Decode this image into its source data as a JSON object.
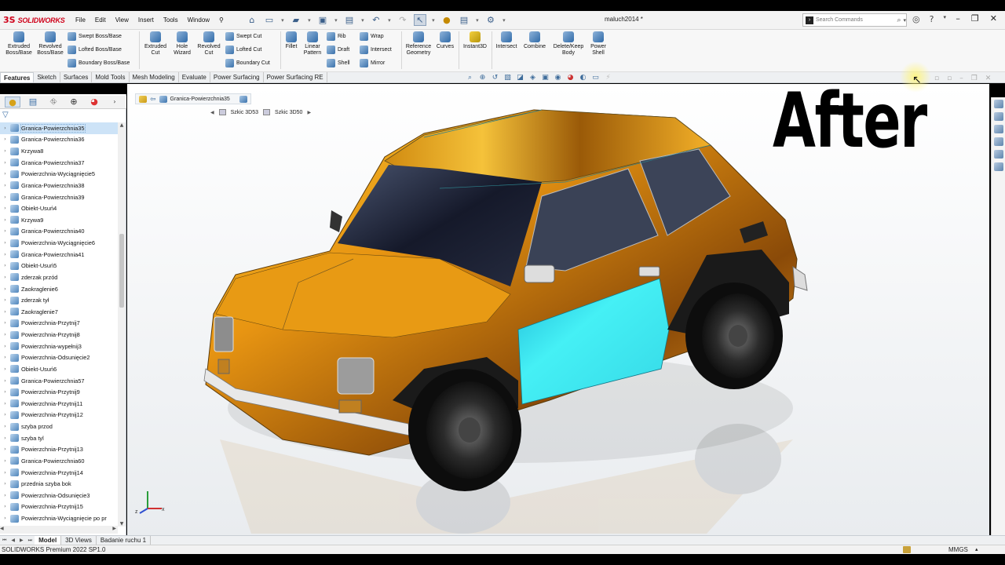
{
  "app": {
    "logo_mark": "3S",
    "logo_text": "SOLIDWORKS",
    "document_title": "maluch2014 *"
  },
  "menu": [
    "File",
    "Edit",
    "View",
    "Insert",
    "Tools",
    "Window"
  ],
  "search": {
    "placeholder": "Search Commands"
  },
  "ribbon": {
    "extruded_boss": "Extruded Boss/Base",
    "revolved_boss": "Revolved Boss/Base",
    "swept_boss": "Swept Boss/Base",
    "lofted_boss": "Lofted Boss/Base",
    "boundary_boss": "Boundary Boss/Base",
    "extruded_cut": "Extruded Cut",
    "hole_wizard": "Hole Wizard",
    "revolved_cut": "Revolved Cut",
    "swept_cut": "Swept Cut",
    "lofted_cut": "Lofted Cut",
    "boundary_cut": "Boundary Cut",
    "fillet": "Fillet",
    "linear_pattern": "Linear Pattern",
    "rib": "Rib",
    "draft": "Draft",
    "shell": "Shell",
    "wrap": "Wrap",
    "intersect_small": "Intersect",
    "mirror": "Mirror",
    "reference_geometry": "Reference Geometry",
    "curves": "Curves",
    "instant3d": "Instant3D",
    "intersect": "Intersect",
    "combine": "Combine",
    "delete_keep_body": "Delete/Keep Body",
    "power_shell": "Power Shell"
  },
  "tabs": [
    "Features",
    "Sketch",
    "Surfaces",
    "Mold Tools",
    "Mesh Modeling",
    "Evaluate",
    "Power Surfacing",
    "Power Surfacing RE"
  ],
  "breadcrumb": {
    "feature": "Granica-Powierzchnia35",
    "sketch_a": "Szkic 3D53",
    "sketch_b": "Szkic 3D50"
  },
  "tree": [
    {
      "label": "Granica-Powierzchnia35",
      "selected": true
    },
    {
      "label": "Granica-Powierzchnia36"
    },
    {
      "label": "Krzywa8"
    },
    {
      "label": "Granica-Powierzchnia37"
    },
    {
      "label": "Powierzchnia-Wyciągnięcie5"
    },
    {
      "label": "Granica-Powierzchnia38"
    },
    {
      "label": "Granica-Powierzchnia39"
    },
    {
      "label": "Obiekt-Usuń4"
    },
    {
      "label": "Krzywa9"
    },
    {
      "label": "Granica-Powierzchnia40"
    },
    {
      "label": "Powierzchnia-Wyciągnięcie6"
    },
    {
      "label": "Granica-Powierzchnia41"
    },
    {
      "label": "Obiekt-Usuń5"
    },
    {
      "label": "zderzak przód"
    },
    {
      "label": "Zaokraglenie6"
    },
    {
      "label": "zderzak tył"
    },
    {
      "label": "Zaokraglenie7"
    },
    {
      "label": "Powierzchnia-Przytnij7"
    },
    {
      "label": "Powierzchnia-Przytnij8"
    },
    {
      "label": "Powierzchnia-wypełnij3"
    },
    {
      "label": "Powierzchnia-Odsunięcie2"
    },
    {
      "label": "Obiekt-Usuń6"
    },
    {
      "label": "Granica-Powierzchnia57"
    },
    {
      "label": "Powierzchnia-Przytnij9"
    },
    {
      "label": "Powierzchnia-Przytnij11"
    },
    {
      "label": "Powierzchnia-Przytnij12"
    },
    {
      "label": "szyba przod"
    },
    {
      "label": "szyba tyl"
    },
    {
      "label": "Powierzchnia-Przytnij13"
    },
    {
      "label": "Granica-Powierzchnia60"
    },
    {
      "label": "Powierzchnia-Przytnij14"
    },
    {
      "label": "przednia szyba bok"
    },
    {
      "label": "Powierzchnia-Odsunięcie3"
    },
    {
      "label": "Powierzchnia-Przytnij15"
    },
    {
      "label": "Powierzchnia-Wyciągnięcie po pr"
    }
  ],
  "overlay_text": "After",
  "bottom_tabs": [
    "Model",
    "3D Views",
    "Badanie ruchu 1"
  ],
  "status": {
    "version": "SOLIDWORKS Premium 2022 SP1.0",
    "units": "MMGS"
  },
  "colors": {
    "body_orange": "#e9950f",
    "selected_surface": "#3ee8f0",
    "brand_red": "#d0021b"
  }
}
